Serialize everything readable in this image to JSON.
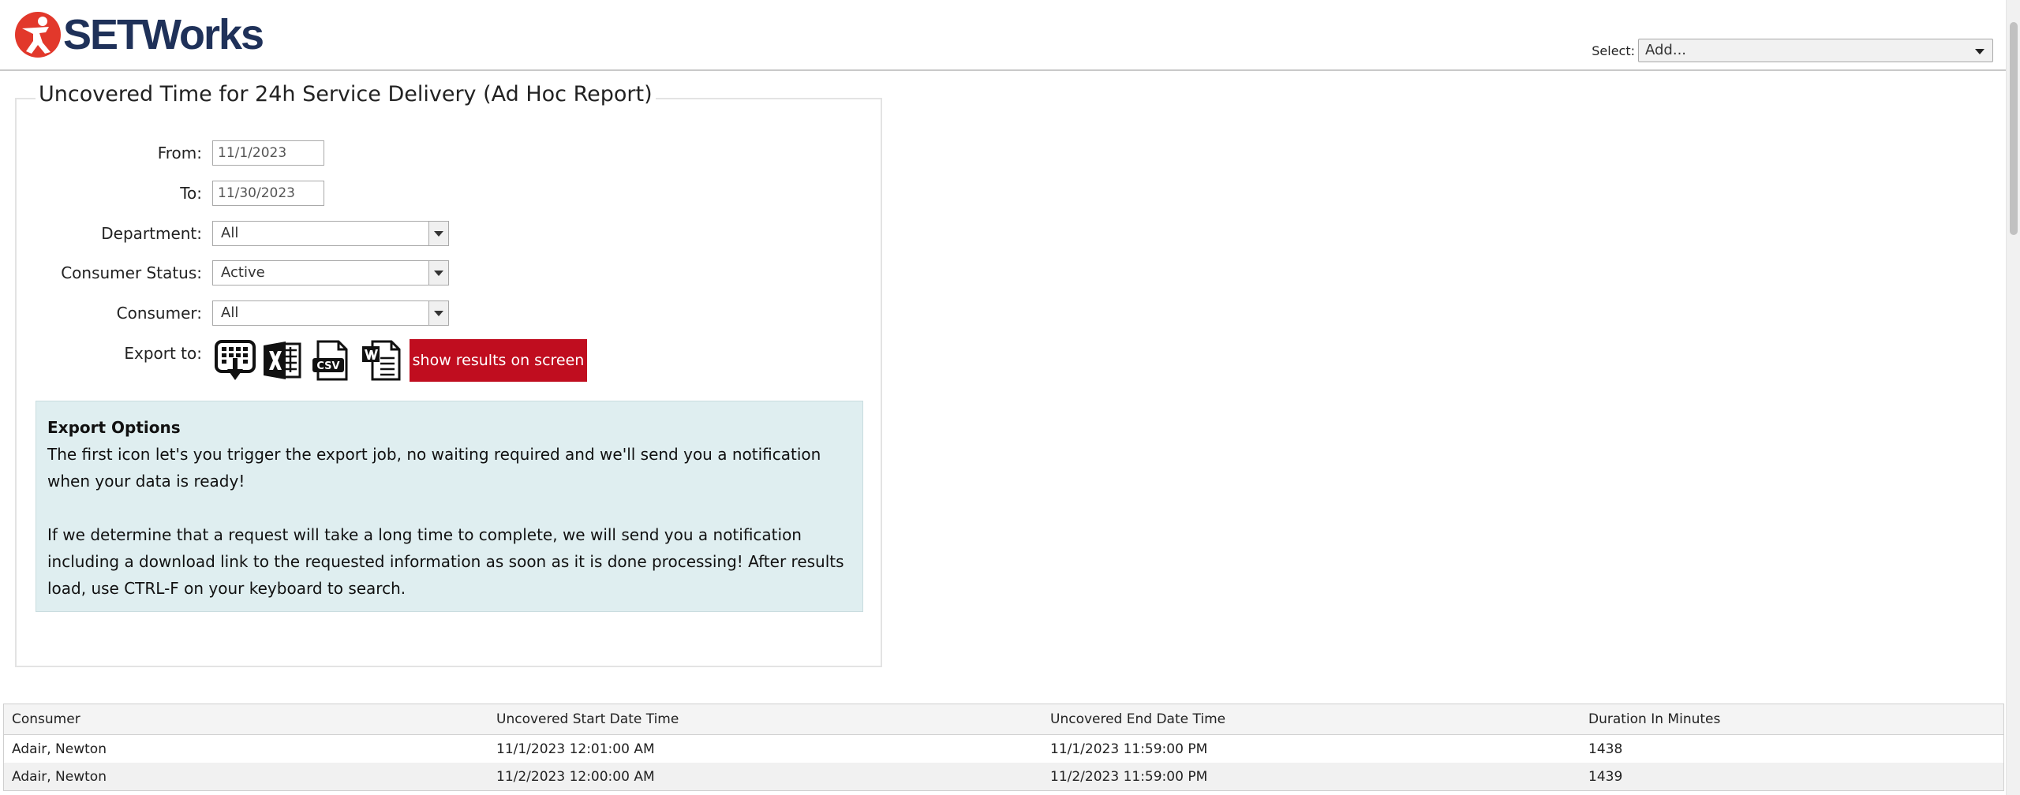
{
  "brand": {
    "name": "SETWorks"
  },
  "header": {
    "select_label": "Select:",
    "select_value": "Add..."
  },
  "report": {
    "title": "Uncovered Time for 24h Service Delivery (Ad Hoc Report)"
  },
  "form": {
    "from_label": "From:",
    "from_value": "11/1/2023",
    "to_label": "To:",
    "to_value": "11/30/2023",
    "department_label": "Department:",
    "department_value": "All",
    "status_label": "Consumer Status:",
    "status_value": "Active",
    "consumer_label": "Consumer:",
    "consumer_value": "All",
    "export_label": "Export to:",
    "show_results_label": "show results on screen"
  },
  "export_icons": [
    "queue-export-icon",
    "excel-icon",
    "csv-icon",
    "word-icon"
  ],
  "info": {
    "title": "Export Options",
    "para1": "The first icon let's you trigger the export job, no waiting required and we'll send you a notification when your data is ready!",
    "para2": "If we determine that a request will take a long time to complete, we will send you a notification including a download link to the requested information as soon as it is done processing! After results load, use CTRL-F on your keyboard to search."
  },
  "table": {
    "columns": [
      "Consumer",
      "Uncovered Start Date Time",
      "Uncovered End Date Time",
      "Duration In Minutes"
    ],
    "rows": [
      [
        "Adair, Newton",
        "11/1/2023 12:01:00 AM",
        "11/1/2023 11:59:00 PM",
        "1438"
      ],
      [
        "Adair, Newton",
        "11/2/2023 12:00:00 AM",
        "11/2/2023 11:59:00 PM",
        "1439"
      ]
    ]
  },
  "colors": {
    "brand_navy": "#1f3159",
    "brand_red": "#e2382b",
    "button_red": "#c00d1f",
    "info_bg": "#dfeef0"
  }
}
